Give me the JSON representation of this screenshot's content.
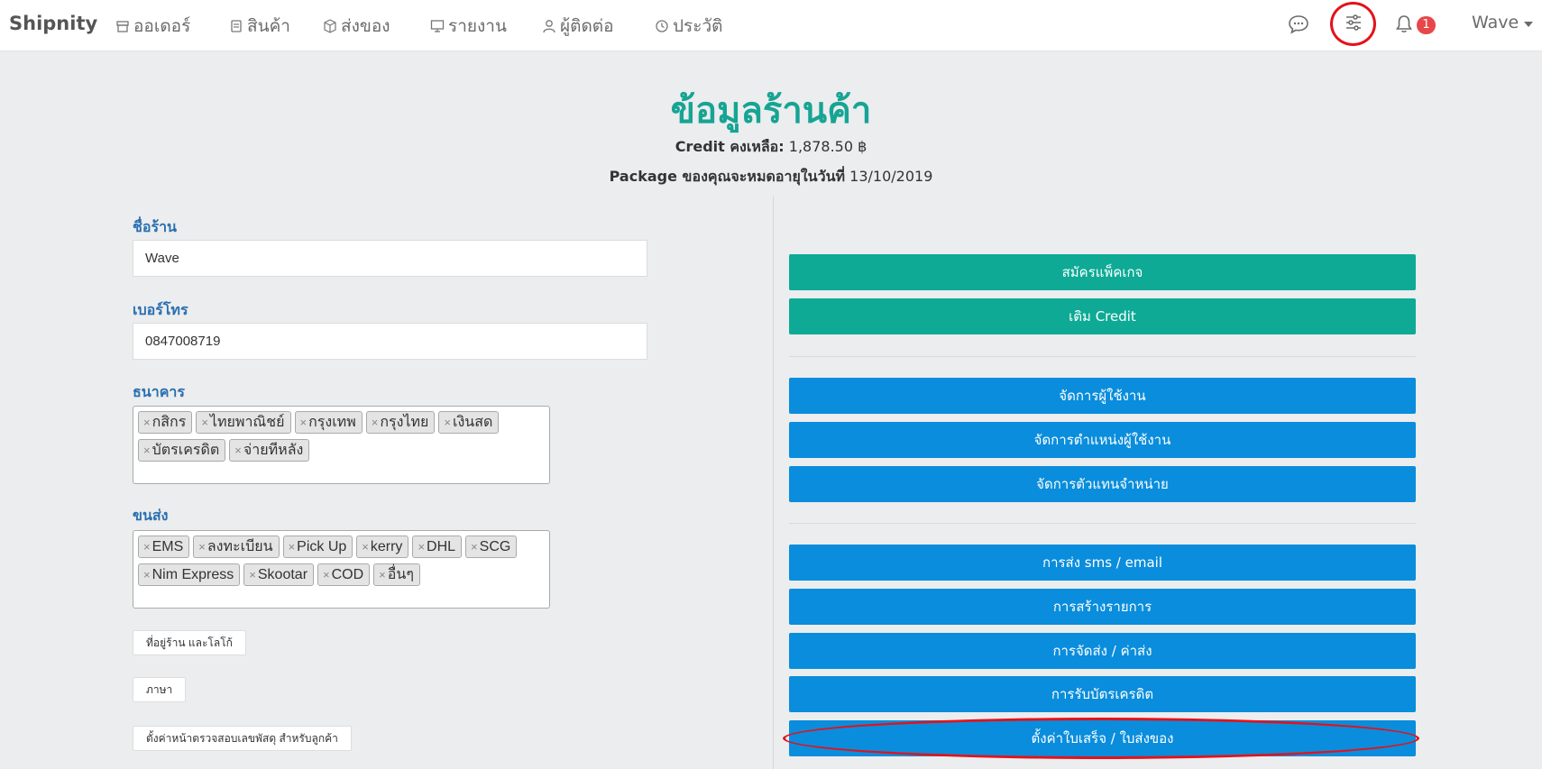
{
  "navbar": {
    "brand": "Shipnity",
    "items": [
      {
        "label": "ออเดอร์",
        "icon": "store-icon"
      },
      {
        "label": "สินค้า",
        "icon": "product-tag-icon"
      },
      {
        "label": "ส่งของ",
        "icon": "box-icon"
      },
      {
        "label": "รายงาน",
        "icon": "monitor-icon"
      },
      {
        "label": "ผู้ติดต่อ",
        "icon": "user-icon"
      },
      {
        "label": "ประวัติ",
        "icon": "history-icon"
      }
    ],
    "notification_count": "1",
    "user": "Wave"
  },
  "header": {
    "title": "ข้อมูลร้านค้า",
    "credit_label": "Credit คงเหลือ:",
    "credit_value": "1,878.50 ฿",
    "package_label": "Package ของคุณจะหมดอายุในวันที่",
    "package_value": "13/10/2019"
  },
  "form": {
    "shop_name_label": "ชื่อร้าน",
    "shop_name_value": "Wave",
    "phone_label": "เบอร์โทร",
    "phone_value": "0847008719",
    "bank_label": "ธนาคาร",
    "banks": [
      "กสิกร",
      "ไทยพาณิชย์",
      "กรุงเทพ",
      "กรุงไทย",
      "เงินสด",
      "บัตรเครดิต",
      "จ่ายทีหลัง"
    ],
    "shipping_label": "ขนส่ง",
    "shipping": [
      "EMS",
      "ลงทะเบียน",
      "Pick Up",
      "kerry",
      "DHL",
      "SCG",
      "Nim Express",
      "Skootar",
      "COD",
      "อื่นๆ"
    ],
    "address_logo_button": "ที่อยู่ร้าน และโลโก้",
    "language_button": "ภาษา",
    "tracking_page_button": "ตั้งค่าหน้าตรวจสอบเลขพัสดุ สำหรับลูกค้า"
  },
  "actions": {
    "register_package": "สมัครแพ็คเกจ",
    "top_up_credit": "เติม Credit",
    "manage_users": "จัดการผู้ใช้งาน",
    "manage_positions": "จัดการตำแหน่งผู้ใช้งาน",
    "manage_dealers": "จัดการตัวแทนจำหน่าย",
    "sms_email": "การส่ง sms / email",
    "create_items": "การสร้างรายการ",
    "shipping_fee": "การจัดส่ง / ค่าส่ง",
    "credit_card": "การรับบัตรเครดิต",
    "receipt_settings": "ตั้งค่าใบเสร็จ / ใบส่งของ"
  },
  "colors": {
    "title": "#17a493",
    "green_button": "#0eaa96",
    "blue_button": "#0a8ddc",
    "highlight": "#e3121b",
    "label": "#2a6fb0"
  }
}
